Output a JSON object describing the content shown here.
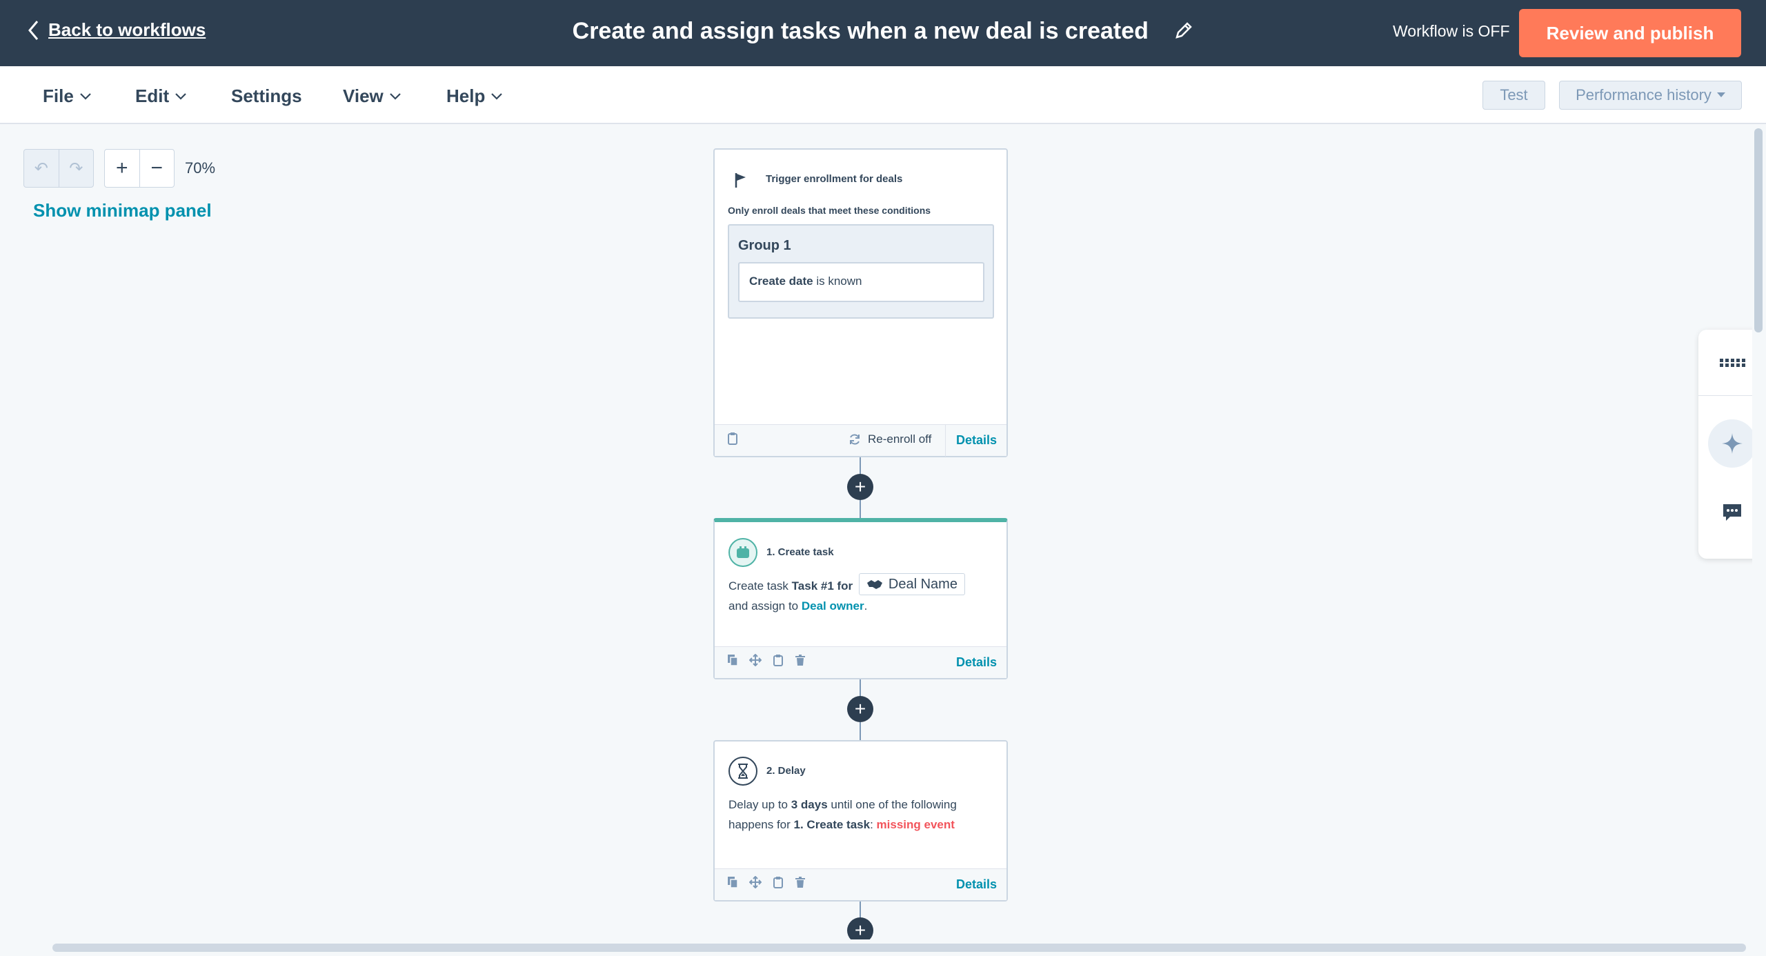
{
  "header": {
    "back_label": "Back to workflows",
    "title": "Create and assign tasks when a new deal is created",
    "status": "Workflow is OFF",
    "publish_label": "Review and publish",
    "brand_color": "#ff7a59"
  },
  "menu": {
    "file": "File",
    "edit": "Edit",
    "settings": "Settings",
    "view": "View",
    "help": "Help",
    "test": "Test",
    "performance": "Performance history"
  },
  "canvas": {
    "zoom": "70%",
    "minimap_link": "Show minimap panel"
  },
  "trigger": {
    "title": "Trigger enrollment for deals",
    "subtitle": "Only enroll deals that meet these conditions",
    "group_label": "Group 1",
    "condition_bold": "Create date",
    "condition_rest": " is known",
    "reenroll": "Re-enroll off",
    "details": "Details"
  },
  "step1": {
    "title": "1. Create task",
    "text_a": "Create task ",
    "task_name": "Task #1 for",
    "token": "Deal Name",
    "text_b": "and assign to ",
    "owner": "Deal owner",
    "period": ".",
    "details": "Details"
  },
  "step2": {
    "title": "2. Delay",
    "text_a": "Delay up to ",
    "duration": "3 days",
    "text_b": " until one of the following",
    "text_c": "happens for ",
    "ref": "1. Create task",
    "colon": ": ",
    "missing": "missing event",
    "details": "Details"
  }
}
